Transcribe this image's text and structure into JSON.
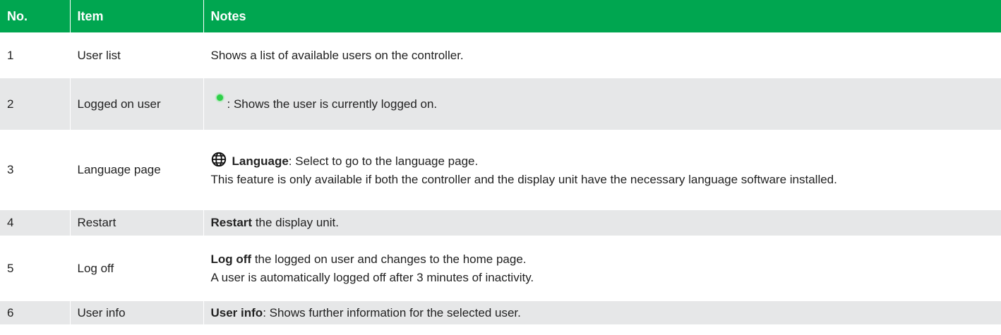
{
  "headers": {
    "no": "No.",
    "item": "Item",
    "notes": "Notes"
  },
  "rows": [
    {
      "no": "1",
      "item": "User list",
      "note": "Shows a list of available users on the controller."
    },
    {
      "no": "2",
      "item": "Logged on user",
      "icon": "green-dot-icon",
      "note": ": Shows the user is currently logged on."
    },
    {
      "no": "3",
      "item": "Language page",
      "icon": "globe-icon",
      "note_bold": "Language",
      "note": ": Select to go to the language page.",
      "note_line2": "This feature is only available if both the controller and the display unit have the necessary language software installed."
    },
    {
      "no": "4",
      "item": "Restart",
      "note_bold": "Restart",
      "note": " the display unit."
    },
    {
      "no": "5",
      "item": "Log off",
      "note_bold": "Log off",
      "note": " the logged on user and changes to the home page.",
      "note_line2": "A user is automatically logged off after 3 minutes of inactivity."
    },
    {
      "no": "6",
      "item": "User info",
      "note_bold": "User info",
      "note": ": Shows further information for the selected user."
    }
  ],
  "colors": {
    "header_bg": "#00a650",
    "row_alt_bg": "#e6e7e8",
    "status_dot": "#2fcf4a"
  }
}
